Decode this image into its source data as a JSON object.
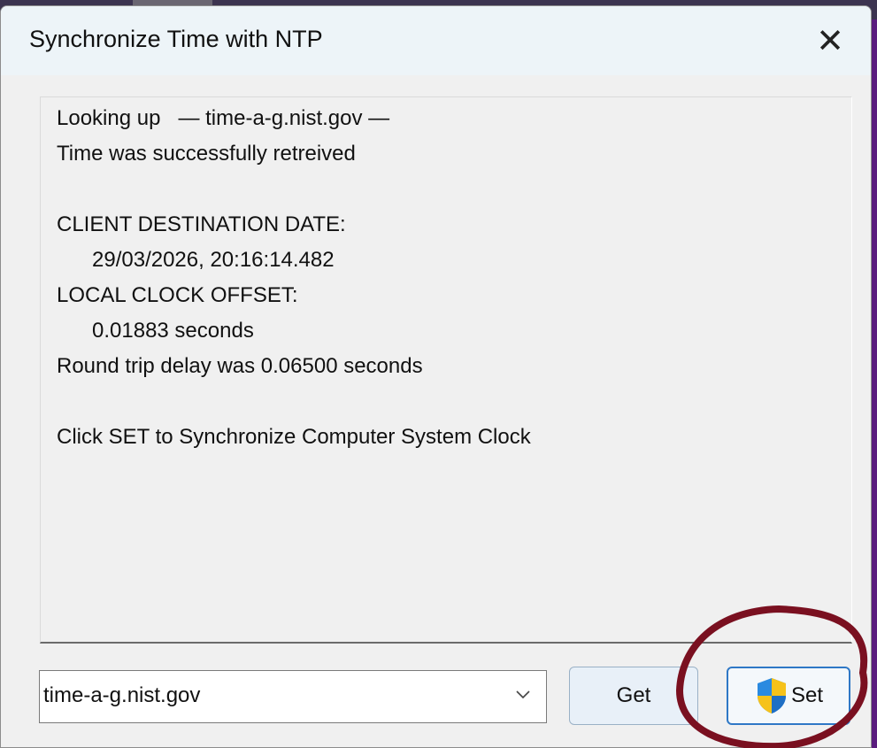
{
  "dialog": {
    "title": "Synchronize Time with NTP",
    "close_glyph": "✕"
  },
  "log": {
    "lines": [
      "Looking up   — time-a-g.nist.gov —",
      "Time was successfully retreived",
      "",
      "CLIENT DESTINATION DATE:",
      "      29/03/2026, 20:16:14.482",
      "LOCAL CLOCK OFFSET:",
      "      0.01883 seconds",
      "Round trip delay was 0.06500 seconds",
      "",
      "Click SET to Synchronize Computer System Clock"
    ]
  },
  "controls": {
    "server": "time-a-g.nist.gov",
    "get_label": "Get",
    "set_label": "Set"
  },
  "icons": {
    "close": "close-icon",
    "dropdown": "chevron-down-icon",
    "uac": "uac-shield-icon"
  },
  "colors": {
    "titlebar": "#edf4f8",
    "set_border": "#2f78c6",
    "annotation": "#7a1020",
    "desktop": "#5a1c7e"
  }
}
